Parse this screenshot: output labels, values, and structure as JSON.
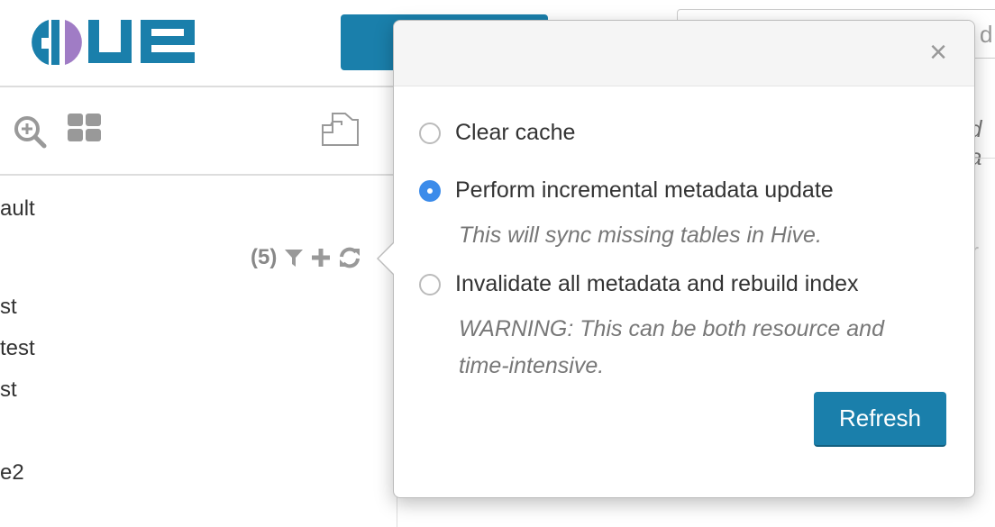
{
  "header": {
    "logo_text": "HUE",
    "brand_color": "#1a7fab",
    "search_fragment": "d c"
  },
  "toolbar": {
    "icons": [
      "search-plus-icon",
      "grid-icon",
      "folder-open-icon"
    ]
  },
  "sidebar": {
    "items": [
      "ault",
      "st",
      "test",
      "st",
      "e2"
    ],
    "database_count": "(5)",
    "action_icons": [
      "filter-icon",
      "plus-icon",
      "refresh-icon"
    ]
  },
  "background": {
    "italic_fragment": "d a",
    "faint_fragment": "r"
  },
  "popover": {
    "close_label": "×",
    "options": [
      {
        "label": "Clear cache",
        "checked": false
      },
      {
        "label": "Perform incremental metadata update",
        "checked": true,
        "description": "This will sync missing tables in Hive."
      },
      {
        "label": "Invalidate all metadata and rebuild index",
        "checked": false,
        "description_line1": "WARNING: This can be both resource and",
        "description_line2": "time-intensive."
      }
    ],
    "refresh_label": "Refresh",
    "radio_color": "#3b8bea"
  }
}
